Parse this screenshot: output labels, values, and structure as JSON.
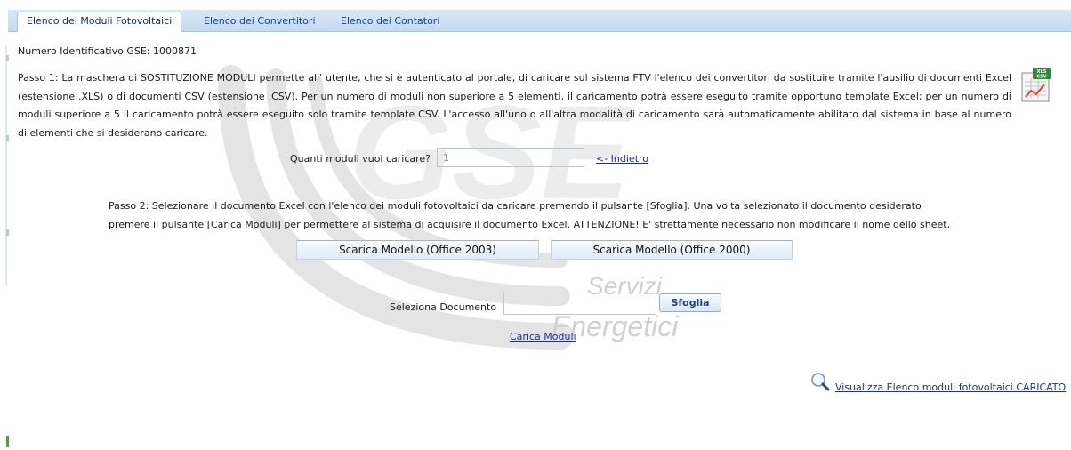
{
  "tabs": [
    {
      "label": "Elenco dei Moduli Fotovoltaici",
      "active": true
    },
    {
      "label": "Elenco dei Convertitori",
      "active": false
    },
    {
      "label": "Elenco dei Contatori",
      "active": false
    }
  ],
  "gse_id": "Numero Identificativo GSE: 1000871",
  "step1_text": "Passo 1: La maschera di SOSTITUZIONE MODULI permette all' utente, che si è autenticato al portale, di caricare sul sistema FTV l'elenco dei convertitori da sostituire tramite l'ausilio di documenti Excel (estensione .XLS) o di documenti CSV (estensione .CSV). Per un numero di moduli non superiore a 5 elementi, il caricamento potrà essere eseguito tramite opportuno template Excel; per un numero di moduli superiore a 5 il caricamento potrà essere eseguito solo tramite template CSV. L'accesso all'uno o all'altra modalità di caricamento sarà automaticamente abilitato dal sistema in base al numero di elementi che si desiderano caricare.",
  "file_icon": {
    "name": "xls-csv-icon",
    "badge": "XLS CSV"
  },
  "quantity": {
    "label": "Quanti moduli vuoi caricare?",
    "value": "1"
  },
  "back_link": "<- Indietro",
  "step2_line1": "Passo 2: Selezionare il documento Excel con l'elenco dei moduli fotovoltaici da caricare premendo il pulsante [Sfoglia]. Una volta selezionato il documento desiderato",
  "step2_line2": "premere il pulsante [Carica Moduli] per permettere al sistema di acquisire il documento Excel. ATTENZIONE! E' strettamente necessario non modificare il nome dello sheet.",
  "templates": {
    "office2003": "Scarica Modello (Office 2003)",
    "office2000": "Scarica Modello (Office 2000)"
  },
  "document": {
    "label": "Seleziona Documento",
    "value": "",
    "browse_label": "Sfoglia"
  },
  "upload_link": "Carica Moduli",
  "view_link": "Visualizza Elenco moduli fotovoltaici CARICATO",
  "watermark": {
    "logo": "GSE",
    "line1": "Servizi",
    "line2": "Energetici"
  },
  "colors": {
    "tab_text": "#15428b",
    "link": "#1a2fa0",
    "tab_bar": "#c6daf0",
    "watermark": "#c4c4c4"
  }
}
